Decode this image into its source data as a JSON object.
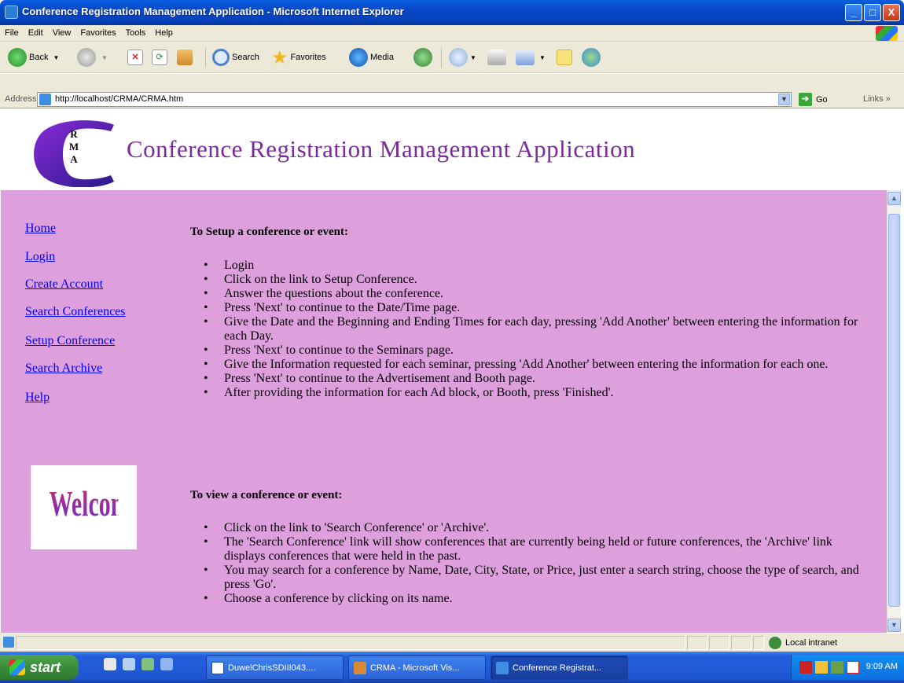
{
  "window": {
    "title": "Conference Registration Management Application - Microsoft Internet Explorer",
    "minimize": "_",
    "maximize": "□",
    "close": "X"
  },
  "menu": [
    "File",
    "Edit",
    "View",
    "Favorites",
    "Tools",
    "Help"
  ],
  "toolbar": {
    "back": "Back",
    "search": "Search",
    "favorites": "Favorites",
    "media": "Media"
  },
  "address": {
    "label": "Address",
    "url": "http://localhost/CRMA/CRMA.htm",
    "go": "Go",
    "links": "Links »"
  },
  "banner": {
    "logo_letters": [
      "R",
      "M",
      "A"
    ],
    "heading": "Conference Registration Management Application"
  },
  "nav": {
    "links": [
      "Home",
      "Login",
      "Create Account",
      "Search Conferences",
      "Setup Conference",
      "Search Archive",
      "Help"
    ]
  },
  "welcome_image_text": "Welcome",
  "content": {
    "setup_heading": "To Setup a conference or event:",
    "setup_steps": [
      "Login",
      "Click on the link to Setup Conference.",
      "Answer the questions about the conference.",
      "Press 'Next' to continue to the Date/Time page.",
      "Give the Date and the Beginning and Ending Times for each day, pressing 'Add Another' between entering the information for each Day.",
      "Press 'Next' to continue to the Seminars page.",
      "Give the Information requested for each seminar, pressing 'Add Another' between entering the information for each one.",
      "Press 'Next' to continue to the Advertisement and Booth page.",
      "After providing the information for each Ad block, or Booth, press 'Finished'."
    ],
    "view_heading": "To view a conference or event:",
    "view_steps": [
      "Click on the link to 'Search Conference' or 'Archive'.",
      "The 'Search Conference' link will show conferences that are currently being held or future conferences, the 'Archive' link displays conferences that were held in the past.",
      "You may search for a conference by Name, Date, City, State, or Price, just enter a search string, choose the type of search, and press 'Go'.",
      "Choose a conference by clicking on its name."
    ]
  },
  "status": {
    "zone": "Local intranet"
  },
  "taskbar": {
    "start": "start",
    "tasks": [
      "DuwelChrisSDIII043....",
      "CRMA - Microsoft Vis...",
      "Conference Registrat..."
    ],
    "clock": "9:09 AM"
  },
  "colors": {
    "page_background": "#dda0dd",
    "heading_color": "#7a2a9a",
    "link_color": "#0000ee",
    "visited_link_color": "#8a2be2"
  }
}
